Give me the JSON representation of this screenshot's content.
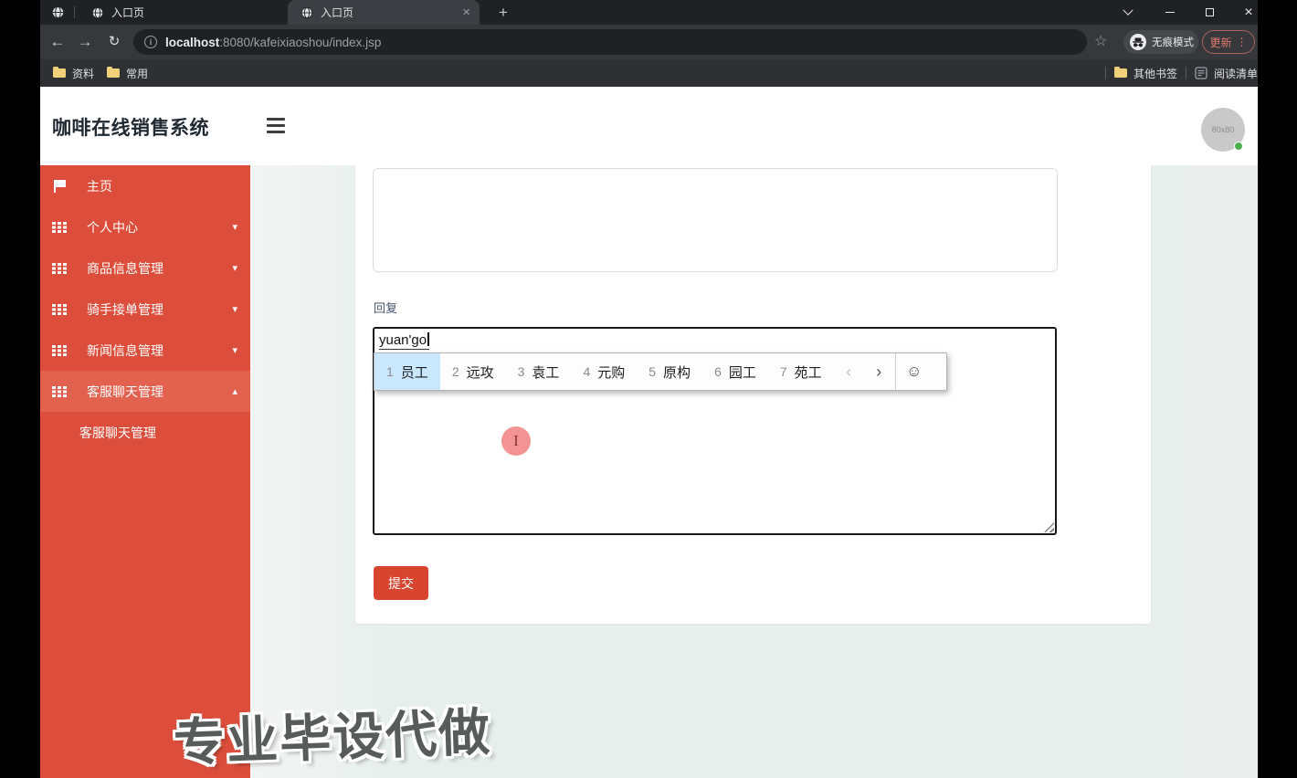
{
  "browser": {
    "tab1_label": "入口页",
    "tab2_label": "入口页",
    "tab_close": "×",
    "new_tab": "+",
    "back": "←",
    "forward": "→",
    "reload": "↻",
    "info": "i",
    "url_host": "localhost",
    "url_rest": ":8080/kafeixiaoshou/index.jsp",
    "star": "☆",
    "incognito_label": "无痕模式",
    "update_label": "更新",
    "update_dots": "⋮",
    "close_glyph": "×",
    "bookmarks": {
      "ziliao": "资料",
      "changyong": "常用",
      "other": "其他书签",
      "reading": "阅读清单"
    }
  },
  "header": {
    "title": "咖啡在线销售系统",
    "avatar_text": "80x80"
  },
  "sidebar": {
    "items": [
      {
        "label": "主页"
      },
      {
        "label": "个人中心"
      },
      {
        "label": "商品信息管理"
      },
      {
        "label": "骑手接单管理"
      },
      {
        "label": "新闻信息管理"
      },
      {
        "label": "客服聊天管理"
      }
    ],
    "caret_down": "▾",
    "caret_up": "▴",
    "submenu_label": "客服聊天管理"
  },
  "form": {
    "reply_label": "回复",
    "composition": "yuan'go",
    "submit_label": "提交"
  },
  "ime": {
    "candidates": [
      {
        "n": "1",
        "t": "员工"
      },
      {
        "n": "2",
        "t": "远攻"
      },
      {
        "n": "3",
        "t": "袁工"
      },
      {
        "n": "4",
        "t": "元购"
      },
      {
        "n": "5",
        "t": "原构"
      },
      {
        "n": "6",
        "t": "园工"
      },
      {
        "n": "7",
        "t": "苑工"
      }
    ],
    "prev": "‹",
    "next": "›",
    "smiley": "☺"
  },
  "overlay": {
    "watermark": "专业毕设代做",
    "cursor_glyph": "I"
  },
  "colors": {
    "sidebar_red": "#dc4e3b",
    "sidebar_active": "#e3614f",
    "submit_red": "#d8452f",
    "candidate_highlight": "#c9e7fd",
    "main_bg": "#e7efec",
    "chrome_frame": "#202124"
  }
}
